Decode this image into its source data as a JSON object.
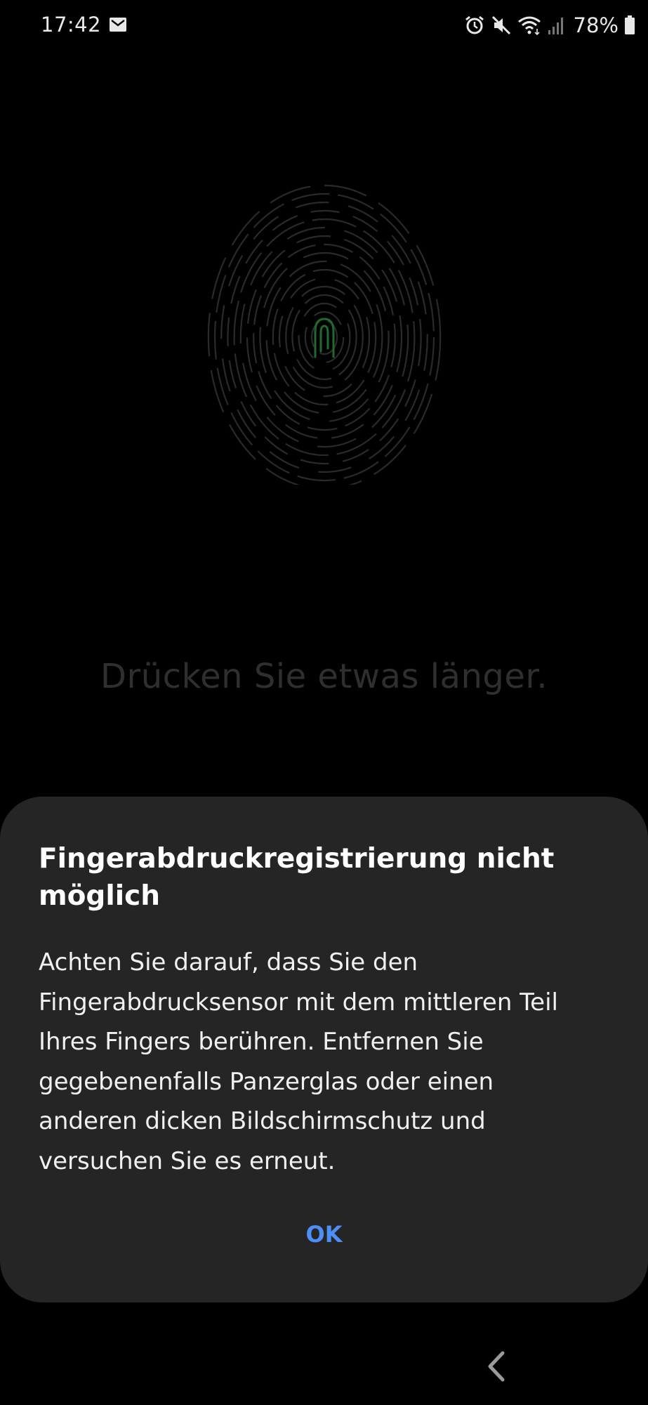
{
  "status_bar": {
    "time": "17:42",
    "battery": "78%",
    "icons": [
      "mail-icon",
      "alarm-icon",
      "mute-icon",
      "wifi-icon",
      "signal-icon",
      "battery-icon"
    ]
  },
  "fingerprint": {
    "icon": "fingerprint-icon",
    "ridge_color": "#2a2a2a",
    "center_color": "#1f6b2e"
  },
  "hint": {
    "text": "Drücken Sie etwas länger."
  },
  "dialog": {
    "title_line1": "Fingerabdruckregistrierung nicht",
    "title_line2": "möglich",
    "message_lines": [
      "Achten Sie darauf, dass Sie den",
      "Fingerabdrucksensor mit dem mittleren Teil",
      "Ihres Fingers berühren. Entfernen Sie",
      "gegebenenfalls Panzerglas oder einen",
      "anderen dicken Bildschirmschutz und",
      "versuchen Sie es erneut."
    ],
    "ok_label": "OK"
  },
  "nav": {
    "back_icon": "chevron-left-icon"
  },
  "colors": {
    "background": "#000000",
    "dialog_bg": "#252525",
    "accent": "#4e8ff7",
    "hint_text": "#2f2f2f"
  }
}
